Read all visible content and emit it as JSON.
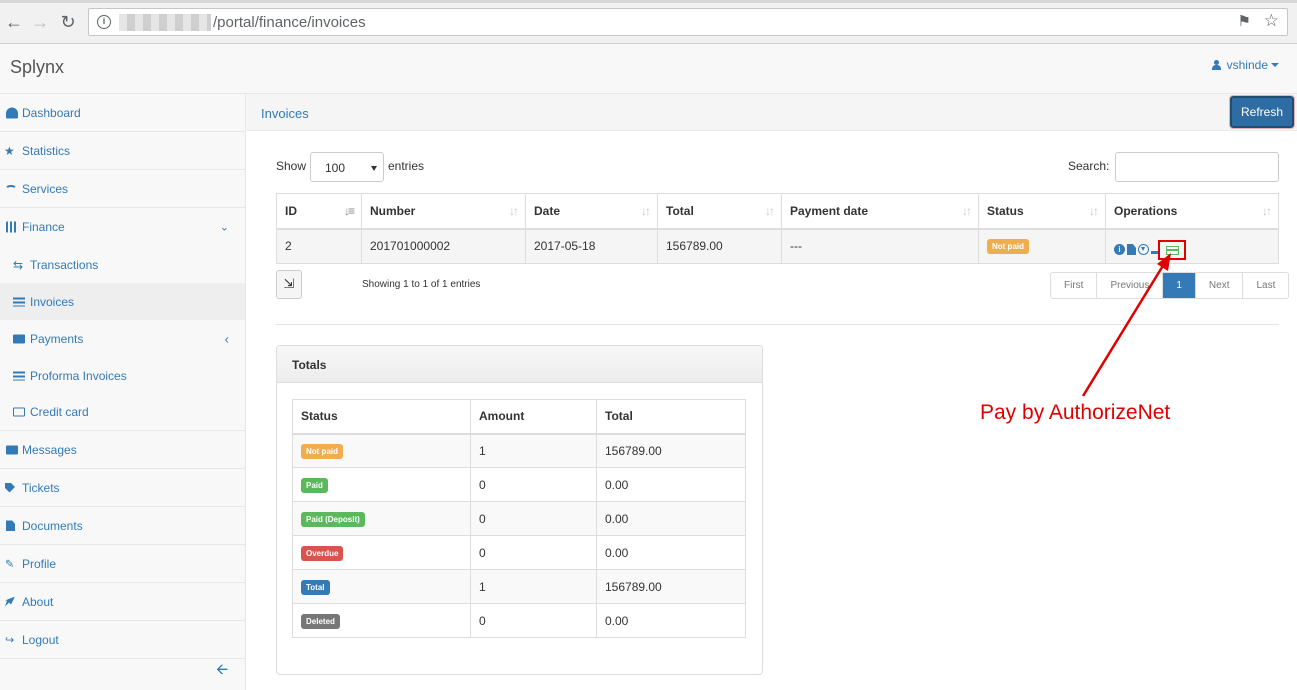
{
  "browser": {
    "url_path": "/portal/finance/invoices"
  },
  "header": {
    "brand": "Splynx",
    "user": "vshinde"
  },
  "sidebar": {
    "items": [
      {
        "label": "Dashboard"
      },
      {
        "label": "Statistics"
      },
      {
        "label": "Services"
      },
      {
        "label": "Finance"
      },
      {
        "label": "Transactions"
      },
      {
        "label": "Invoices"
      },
      {
        "label": "Payments"
      },
      {
        "label": "Proforma Invoices"
      },
      {
        "label": "Credit card"
      },
      {
        "label": "Messages"
      },
      {
        "label": "Tickets"
      },
      {
        "label": "Documents"
      },
      {
        "label": "Profile"
      },
      {
        "label": "About"
      },
      {
        "label": "Logout"
      }
    ]
  },
  "page": {
    "title": "Invoices",
    "refresh_label": "Refresh"
  },
  "controls": {
    "show_label": "Show",
    "entries_value": "100",
    "entries_label": "entries",
    "search_label": "Search:"
  },
  "invoices": {
    "headers": [
      "ID",
      "Number",
      "Date",
      "Total",
      "Payment date",
      "Status",
      "Operations"
    ],
    "rows": [
      {
        "id": "2",
        "number": "201701000002",
        "date": "2017-05-18",
        "total": "156789.00",
        "payment_date": "---",
        "status": "Not paid"
      }
    ]
  },
  "footer": {
    "showing": "Showing 1 to 1 of 1 entries",
    "pager": [
      "First",
      "Previous",
      "1",
      "Next",
      "Last"
    ]
  },
  "totals": {
    "title": "Totals",
    "headers": [
      "Status",
      "Amount",
      "Total"
    ],
    "rows": [
      {
        "status": "Not paid",
        "amount": "1",
        "total": "156789.00"
      },
      {
        "status": "Paid",
        "amount": "0",
        "total": "0.00"
      },
      {
        "status": "Paid (Deposit)",
        "amount": "0",
        "total": "0.00"
      },
      {
        "status": "Overdue",
        "amount": "0",
        "total": "0.00"
      },
      {
        "status": "Total",
        "amount": "1",
        "total": "156789.00"
      },
      {
        "status": "Deleted",
        "amount": "0",
        "total": "0.00"
      }
    ]
  },
  "annotation": {
    "label": "Pay by AuthorizeNet",
    "color": "#e00000"
  },
  "colors": {
    "link": "#337ab7",
    "primary_button": "#2e6da4",
    "not_paid": "#f0ad4e",
    "paid": "#5cb85c",
    "overdue": "#d9534f",
    "deleted": "#777777"
  },
  "icons": [
    "back-icon",
    "forward-icon",
    "reload-icon",
    "info-icon",
    "key-icon",
    "star-icon",
    "user-icon",
    "dashboard-icon",
    "star-icon",
    "wifi-icon",
    "calculator-icon",
    "exchange-icon",
    "list-icon",
    "payment-icon",
    "list-alt-icon",
    "credit-card-icon",
    "envelope-icon",
    "tag-icon",
    "file-icon",
    "pencil-icon",
    "rocket-icon",
    "logout-icon",
    "arrow-left-icon",
    "export-icon",
    "cart-icon",
    "download-icon"
  ]
}
